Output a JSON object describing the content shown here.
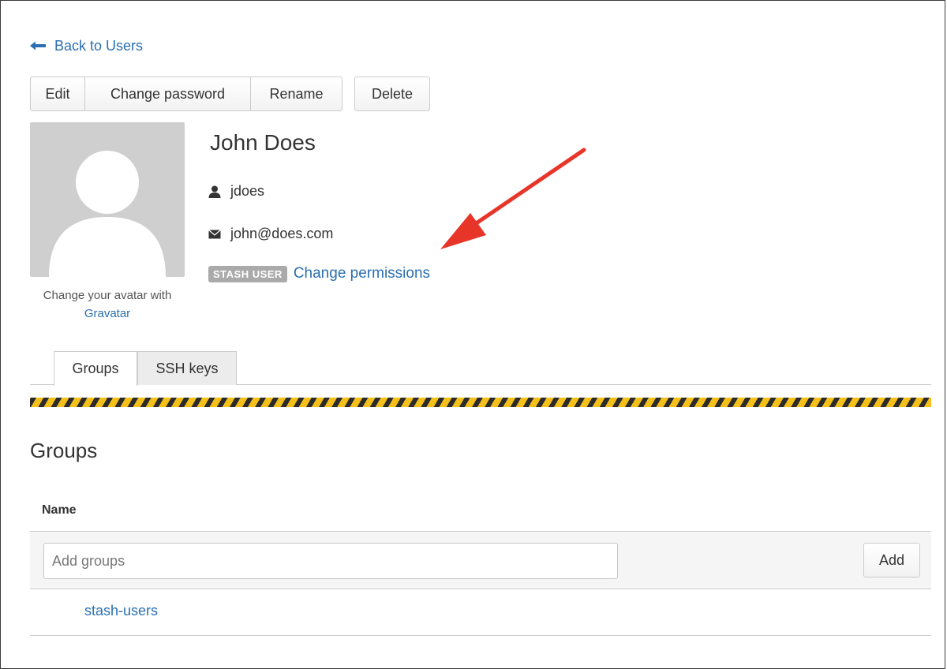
{
  "nav": {
    "back_label": "Back to Users"
  },
  "toolbar": {
    "edit_label": "Edit",
    "change_password_label": "Change password",
    "rename_label": "Rename",
    "delete_label": "Delete"
  },
  "avatar": {
    "caption_prefix": "Change your avatar with",
    "caption_link": "Gravatar"
  },
  "profile": {
    "full_name": "John Does",
    "username": "jdoes",
    "email": "john@does.com",
    "badge": "STASH USER",
    "permissions_link": "Change permissions"
  },
  "tabs": [
    {
      "label": "Groups",
      "active": true
    },
    {
      "label": "SSH keys",
      "active": false
    }
  ],
  "groups_section": {
    "title": "Groups",
    "column_header": "Name",
    "add_placeholder": "Add groups",
    "add_button": "Add",
    "rows": [
      "stash-users"
    ]
  },
  "colors": {
    "link": "#2b6fb0",
    "annotation_arrow": "#e8352a",
    "badge_bg": "#aaaaaa",
    "hazard_yellow": "#f5c01a",
    "hazard_dark": "#2b2b2b"
  },
  "icons": {
    "back": "arrow-left-icon",
    "user": "user-icon",
    "email": "envelope-icon"
  }
}
